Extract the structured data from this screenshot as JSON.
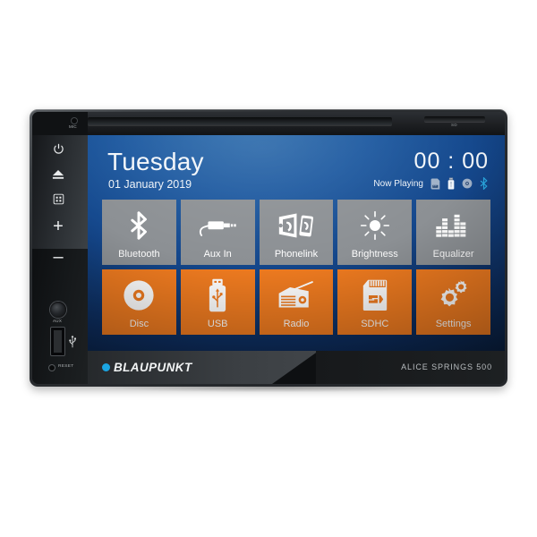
{
  "device": {
    "brand": "BLAUPUNKT",
    "model": "ALICE SPRINGS 500",
    "mic_label": "MIC",
    "sd_slot_label": "SD",
    "aux_label": "AUX",
    "reset_label": "RESET",
    "accent_orange": "#ef7b20",
    "accent_blue": "#1ba5e2",
    "tile_grey": "#8c9094",
    "screen_blue": "#14468a"
  },
  "side_buttons": [
    {
      "name": "power",
      "icon": "power-icon",
      "label": ""
    },
    {
      "name": "eject",
      "icon": "eject-icon",
      "label": ""
    },
    {
      "name": "menu",
      "icon": "grid-menu-icon",
      "label": ""
    },
    {
      "name": "volume-up",
      "icon": "plus-icon",
      "label": "+"
    },
    {
      "name": "volume-down",
      "icon": "minus-icon",
      "label": "–"
    }
  ],
  "ports": [
    {
      "name": "aux-jack",
      "label": "AUX"
    },
    {
      "name": "usb-port",
      "icon": "usb-icon"
    },
    {
      "name": "reset-button",
      "label": "RESET"
    }
  ],
  "screen": {
    "day": "Tuesday",
    "date": "01 January 2019",
    "clock": "00 : 00",
    "now_playing_label": "Now Playing",
    "now_playing_sources": [
      {
        "name": "sd-card",
        "icon": "sd-card-icon",
        "active": false
      },
      {
        "name": "usb",
        "icon": "usb-stick-icon",
        "active": false
      },
      {
        "name": "disc",
        "icon": "disc-icon",
        "active": false
      },
      {
        "name": "bluetooth",
        "icon": "bluetooth-icon",
        "active": true
      }
    ],
    "tiles": [
      {
        "label": "Bluetooth",
        "icon": "bluetooth-icon",
        "style": "grey"
      },
      {
        "label": "Aux In",
        "icon": "aux-plug-icon",
        "style": "grey"
      },
      {
        "label": "Phonelink",
        "icon": "phonelink-icon",
        "style": "grey"
      },
      {
        "label": "Brightness",
        "icon": "sun-icon",
        "style": "grey"
      },
      {
        "label": "Equalizer",
        "icon": "equalizer-icon",
        "style": "grey"
      },
      {
        "label": "Disc",
        "icon": "disc-icon",
        "style": "orange"
      },
      {
        "label": "USB",
        "icon": "usb-stick-icon",
        "style": "orange"
      },
      {
        "label": "Radio",
        "icon": "radio-icon",
        "style": "orange"
      },
      {
        "label": "SDHC",
        "icon": "sd-card-icon",
        "style": "orange"
      },
      {
        "label": "Settings",
        "icon": "gears-icon",
        "style": "orange"
      }
    ]
  }
}
